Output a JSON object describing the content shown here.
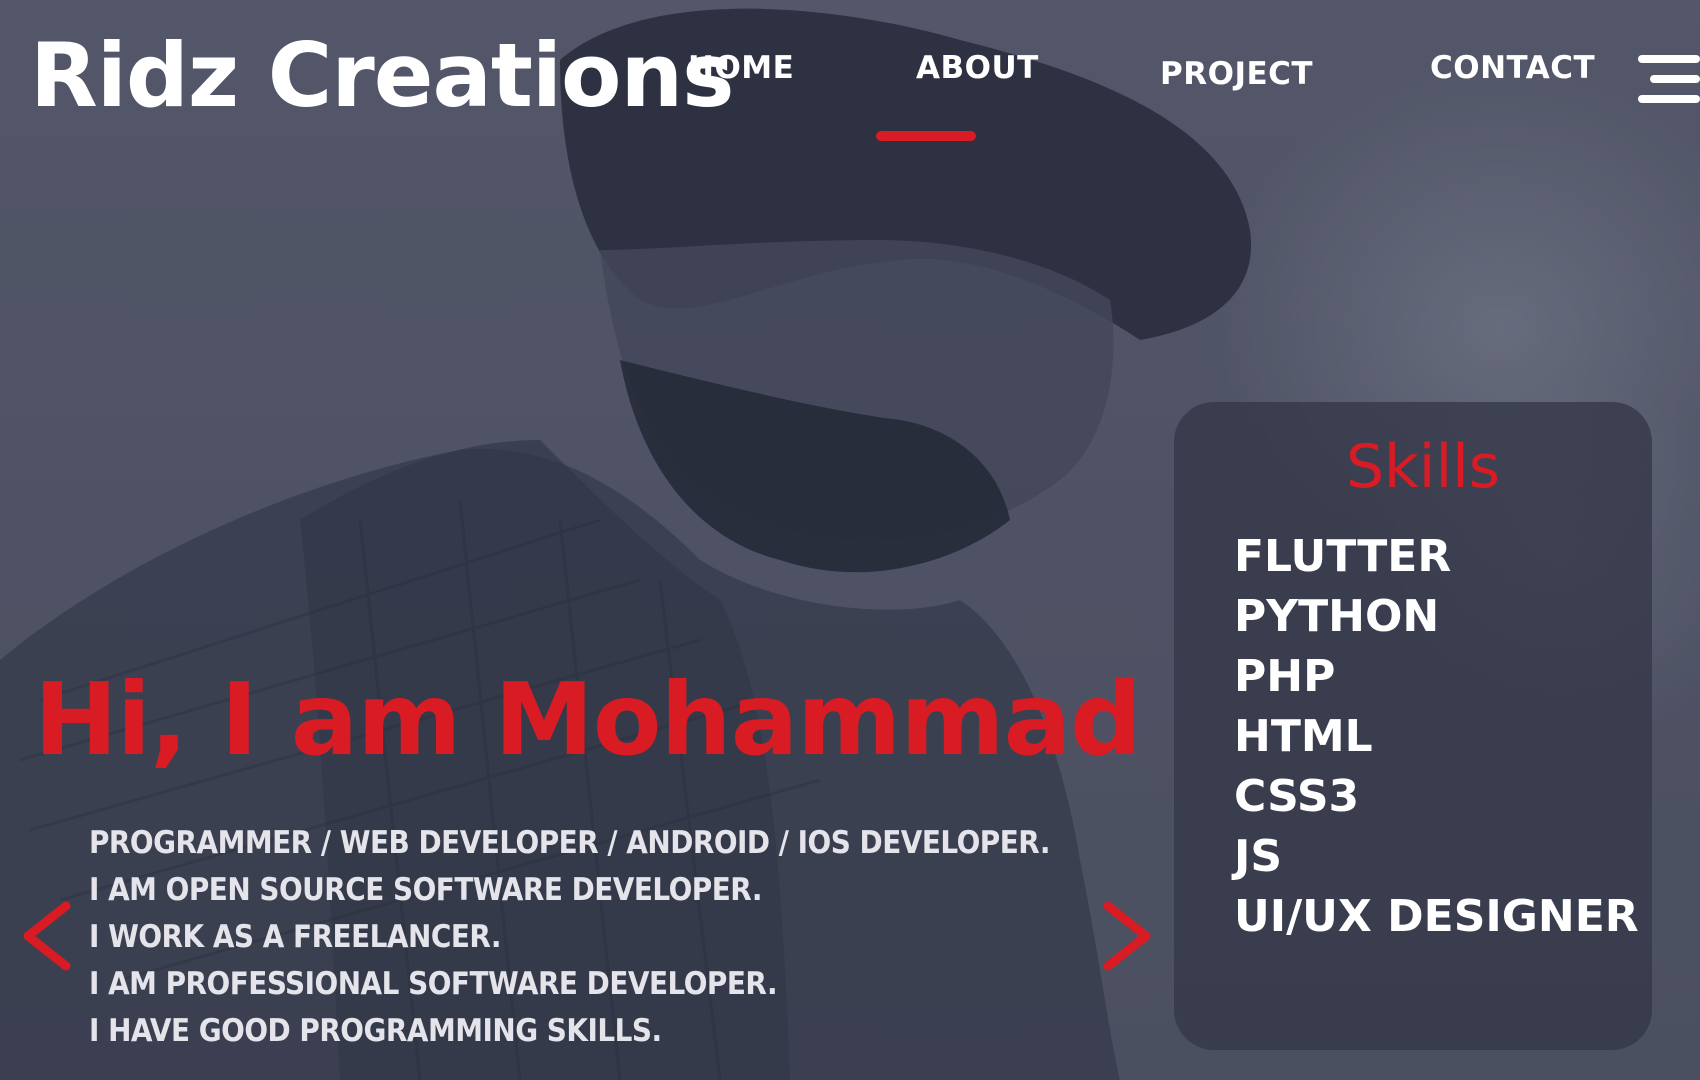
{
  "brand": {
    "logo_text": "Ridz Creations"
  },
  "nav": {
    "items": [
      {
        "label": "HOME",
        "active": false
      },
      {
        "label": "ABOUT",
        "active": true
      },
      {
        "label": "PROJECT",
        "active": false
      },
      {
        "label": "CONTACT",
        "active": false
      }
    ],
    "menu_icon": "hamburger-menu-icon"
  },
  "hero": {
    "title": "Hi, I am Mohammad",
    "lines": [
      "PROGRAMMER / WEB DEVELOPER / ANDROID / IOS DEVELOPER.",
      "I AM OPEN SOURCE SOFTWARE DEVELOPER.",
      "I WORK AS A FREELANCER.",
      "I AM PROFESSIONAL SOFTWARE DEVELOPER.",
      "I HAVE GOOD PROGRAMMING SKILLS."
    ],
    "prev_icon": "chevron-left-icon",
    "next_icon": "chevron-right-icon"
  },
  "skills": {
    "title": "Skills",
    "items": [
      "FLUTTER",
      "PYTHON",
      "PHP",
      "HTML",
      "CSS3",
      "JS",
      "UI/UX DESIGNER"
    ]
  },
  "colors": {
    "accent": "#d91b24",
    "text": "#ffffff",
    "card_bg": "#343748",
    "page_bg": "#5a5e70"
  }
}
